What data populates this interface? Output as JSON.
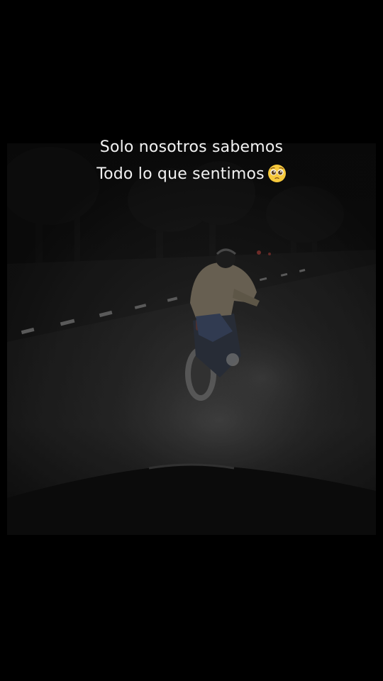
{
  "caption": {
    "line1": "Solo nosotros sabemos",
    "line2": "Todo lo que sentimos",
    "emoji": "pleading-face-emoji"
  },
  "scene": {
    "description_icon": "night-motorcycle-photo"
  }
}
